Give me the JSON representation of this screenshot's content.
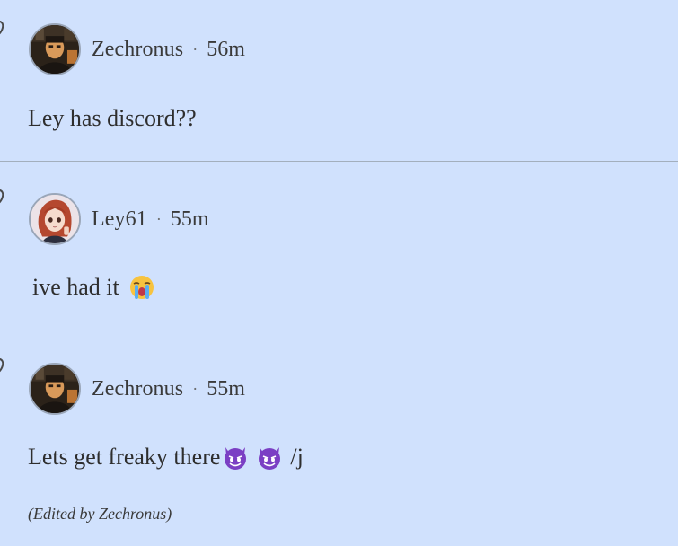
{
  "comments": [
    {
      "username": "Zechronus",
      "separator": "·",
      "time": "56m",
      "text": "Ley has discord??",
      "avatar": "dark-photo-avatar"
    },
    {
      "username": "Ley61",
      "separator": "·",
      "time": "55m",
      "text": "ive had it",
      "emoji": "loudly-crying-face-emoji",
      "avatar": "anime-girl-avatar"
    },
    {
      "username": "Zechronus",
      "separator": "·",
      "time": "55m",
      "text": "Lets get freaky there",
      "emoji": [
        "smiling-devil-emoji",
        "smiling-devil-emoji"
      ],
      "suffix": "/j",
      "edited_note": "(Edited by Zechronus)",
      "avatar": "dark-photo-avatar"
    }
  ],
  "colors": {
    "background": "#d0e1fd",
    "divider": "#a3afbd",
    "text": "#2e2e2e",
    "devil_purple": "#7b3fc4"
  }
}
